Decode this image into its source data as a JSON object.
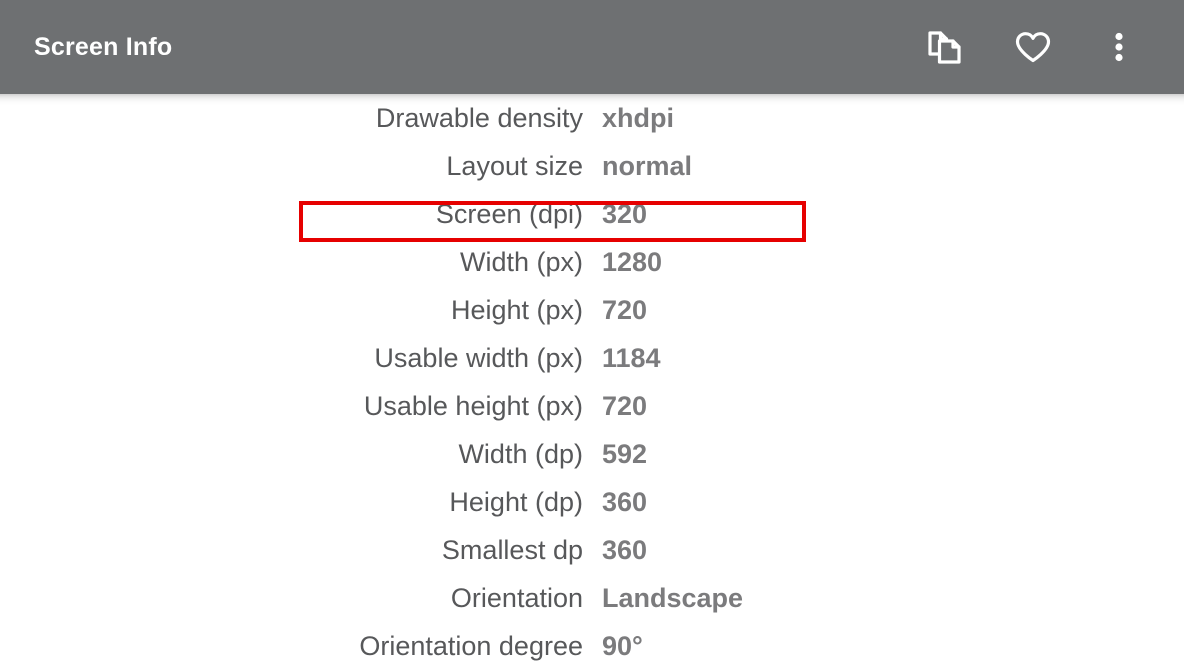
{
  "appbar": {
    "title": "Screen Info",
    "background_color": "#6e7072",
    "title_color": "#ffffff",
    "actions": [
      {
        "name": "copy-icon",
        "label": "Copy"
      },
      {
        "name": "heart-icon",
        "label": "Favorite"
      },
      {
        "name": "overflow-menu-icon",
        "label": "More options"
      }
    ]
  },
  "info": {
    "label_color": "#57585a",
    "value_color": "#7b7b7d",
    "rows": [
      {
        "label": "Drawable density",
        "value": "xhdpi"
      },
      {
        "label": "Layout size",
        "value": "normal"
      },
      {
        "label": "Screen (dpi)",
        "value": "320"
      },
      {
        "label": "Width (px)",
        "value": "1280"
      },
      {
        "label": "Height (px)",
        "value": "720"
      },
      {
        "label": "Usable width (px)",
        "value": "1184"
      },
      {
        "label": "Usable height (px)",
        "value": "720"
      },
      {
        "label": "Width (dp)",
        "value": "592"
      },
      {
        "label": "Height (dp)",
        "value": "360"
      },
      {
        "label": "Smallest dp",
        "value": "360"
      },
      {
        "label": "Orientation",
        "value": "Landscape"
      },
      {
        "label": "Orientation degree",
        "value": "90°"
      }
    ]
  },
  "annotation": {
    "name": "screen-dpi-highlight",
    "target_row_index": 2,
    "color": "#e60000"
  }
}
